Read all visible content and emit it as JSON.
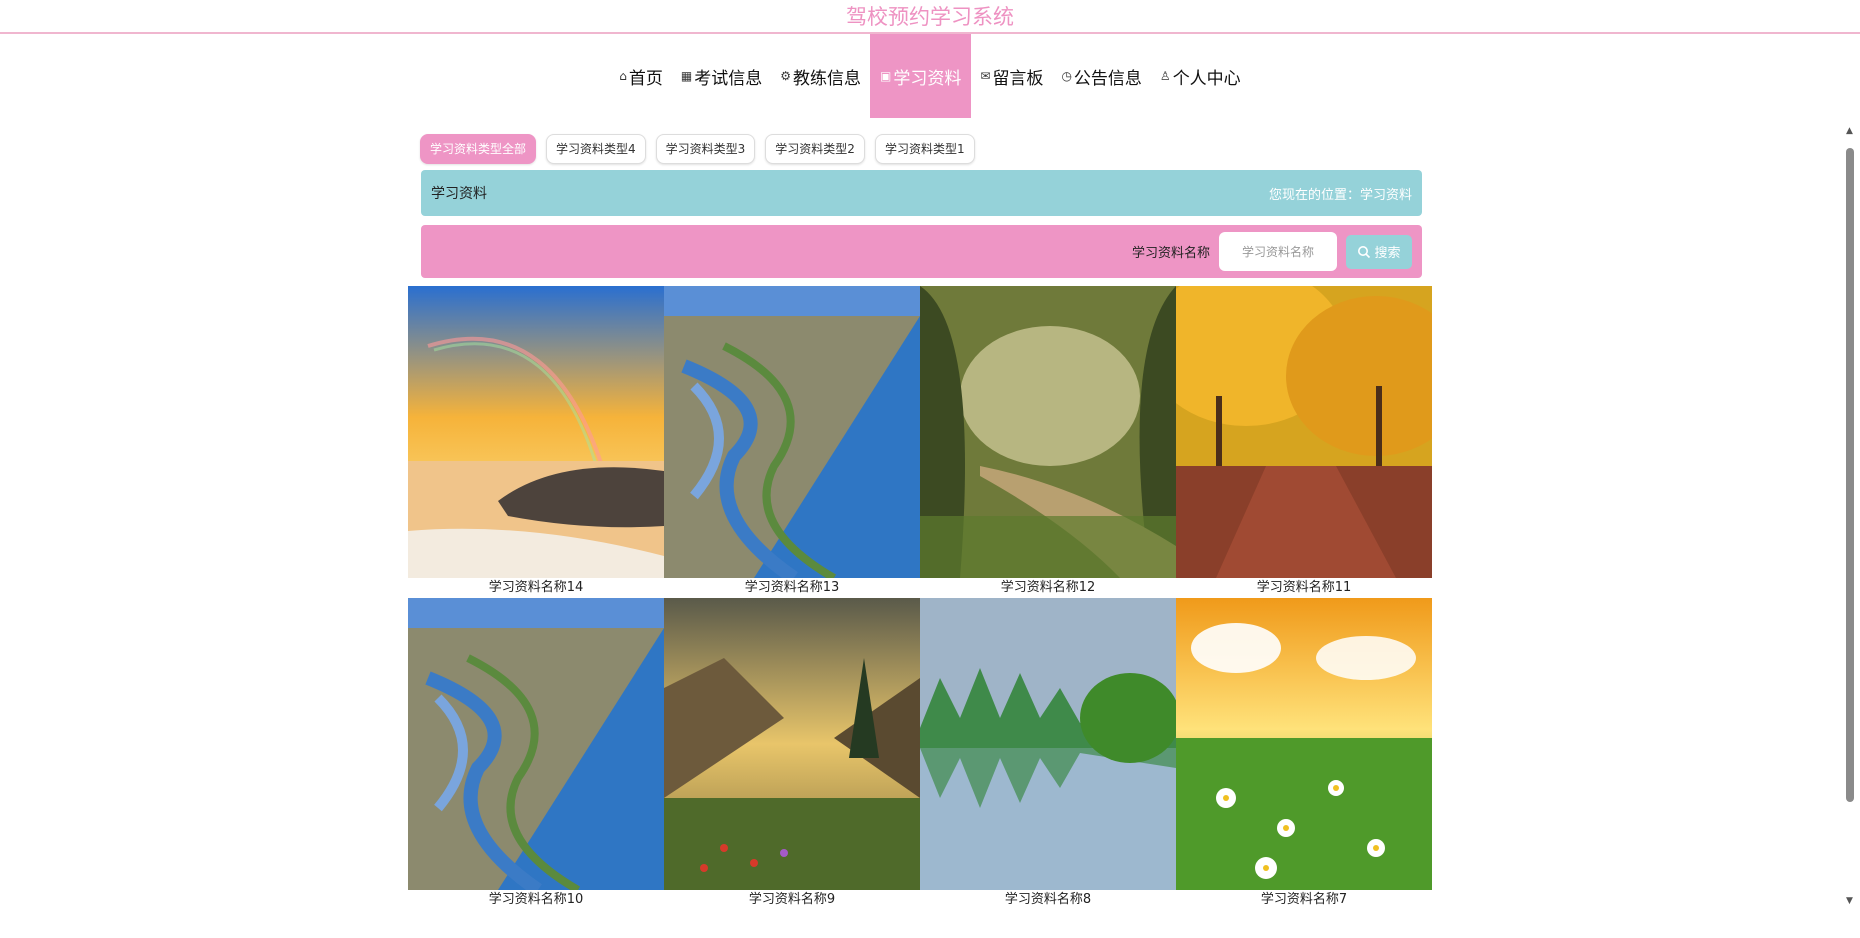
{
  "header": {
    "title": "驾校预约学习系统"
  },
  "nav": {
    "items": [
      {
        "icon": "home-icon",
        "glyph": "⌂",
        "label": "首页"
      },
      {
        "icon": "grid-icon",
        "glyph": "▦",
        "label": "考试信息"
      },
      {
        "icon": "settings-icon",
        "glyph": "⚙",
        "label": "教练信息"
      },
      {
        "icon": "gift-icon",
        "glyph": "▣",
        "label": "学习资料"
      },
      {
        "icon": "mail-icon",
        "glyph": "✉",
        "label": "留言板"
      },
      {
        "icon": "clock-icon",
        "glyph": "◷",
        "label": "公告信息"
      },
      {
        "icon": "user-icon",
        "glyph": "♙",
        "label": "个人中心"
      }
    ],
    "active_index": 3
  },
  "filters": [
    "学习资料类型全部",
    "学习资料类型4",
    "学习资料类型3",
    "学习资料类型2",
    "学习资料类型1"
  ],
  "breadcrumb": {
    "title": "学习资料",
    "location": "您现在的位置：学习资料"
  },
  "search": {
    "label": "学习资料名称",
    "placeholder": "学习资料名称",
    "button": "搜索"
  },
  "cards": [
    {
      "name": "学习资料名称14",
      "scene": "rainbow-beach"
    },
    {
      "name": "学习资料名称13",
      "scene": "shoreline"
    },
    {
      "name": "学习资料名称12",
      "scene": "forest-path"
    },
    {
      "name": "学习资料名称11",
      "scene": "autumn-avenue"
    },
    {
      "name": "学习资料名称10",
      "scene": "shoreline"
    },
    {
      "name": "学习资料名称9",
      "scene": "mountain-valley"
    },
    {
      "name": "学习资料名称8",
      "scene": "karst-lake"
    },
    {
      "name": "学习资料名称7",
      "scene": "daisy-field"
    }
  ],
  "colors": {
    "accent_pink": "#ee95c5",
    "accent_teal": "#95d2d9"
  }
}
